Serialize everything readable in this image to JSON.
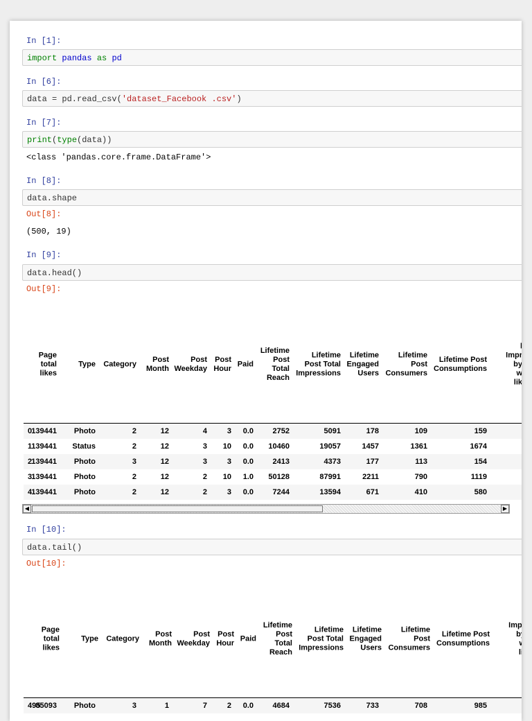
{
  "cells": [
    {
      "prompt": "In [1]:",
      "code": {
        "kw1": "import",
        "mod": "pandas",
        "kw2": "as",
        "alias": "pd"
      }
    },
    {
      "prompt": "In [6]:",
      "code": {
        "pre": "data = pd.read_csv(",
        "str": "'dataset_Facebook .csv'",
        "post": ")"
      }
    },
    {
      "prompt": "In [7]:",
      "code": {
        "fn1": "print",
        "p1": "(",
        "fn2": "type",
        "post": "(data))"
      },
      "output": "<class 'pandas.core.frame.DataFrame'>"
    },
    {
      "prompt": "In [8]:",
      "code": {
        "text": "data.shape"
      },
      "out_prompt": "Out[8]:",
      "output": "(500, 19)"
    },
    {
      "prompt": "In [9]:",
      "code": {
        "text": "data.head()"
      },
      "out_prompt": "Out[9]:"
    },
    {
      "prompt": "In [10]:",
      "code": {
        "text": "data.tail()"
      },
      "out_prompt": "Out[10]:"
    }
  ],
  "table_headers": [
    "Page\ntotal\nlikes",
    "Type",
    "Category",
    "Post\nMonth",
    "Post\nWeekday",
    "Post\nHour",
    "Paid",
    "Lifetime\nPost\nTotal\nReach",
    "Lifetime\nPost Total\nImpressions",
    "Lifetime\nEngaged\nUsers",
    "Lifetime\nPost\nConsumers",
    "Lifetime Post\nConsumptions",
    "l\nImpr\nby\nw\nlik"
  ],
  "tail_headers": [
    "Page\ntotal\nlikes",
    "Type",
    "Category",
    "Post\nMonth",
    "Post\nWeekday",
    "Post\nHour",
    "Paid",
    "Lifetime\nPost\nTotal\nReach",
    "Lifetime\nPost Total\nImpressions",
    "Lifetime\nEngaged\nUsers",
    "Lifetime\nPost\nConsumers",
    "Lifetime Post\nConsumptions",
    "Impr\nby\nw\nlil"
  ],
  "head_rows": [
    [
      "0",
      "139441",
      "Photo",
      "2",
      "12",
      "4",
      "3",
      "0.0",
      "2752",
      "5091",
      "178",
      "109",
      "159"
    ],
    [
      "1",
      "139441",
      "Status",
      "2",
      "12",
      "3",
      "10",
      "0.0",
      "10460",
      "19057",
      "1457",
      "1361",
      "1674"
    ],
    [
      "2",
      "139441",
      "Photo",
      "3",
      "12",
      "3",
      "3",
      "0.0",
      "2413",
      "4373",
      "177",
      "113",
      "154"
    ],
    [
      "3",
      "139441",
      "Photo",
      "2",
      "12",
      "2",
      "10",
      "1.0",
      "50128",
      "87991",
      "2211",
      "790",
      "1119"
    ],
    [
      "4",
      "139441",
      "Photo",
      "2",
      "12",
      "2",
      "3",
      "0.0",
      "7244",
      "13594",
      "671",
      "410",
      "580"
    ]
  ],
  "tail_rows": [
    [
      "495",
      "85093",
      "Photo",
      "3",
      "1",
      "7",
      "2",
      "0.0",
      "4684",
      "7536",
      "733",
      "708",
      "985"
    ]
  ],
  "scrollbar": {
    "left_arrow": "◀",
    "right_arrow": "▶"
  }
}
